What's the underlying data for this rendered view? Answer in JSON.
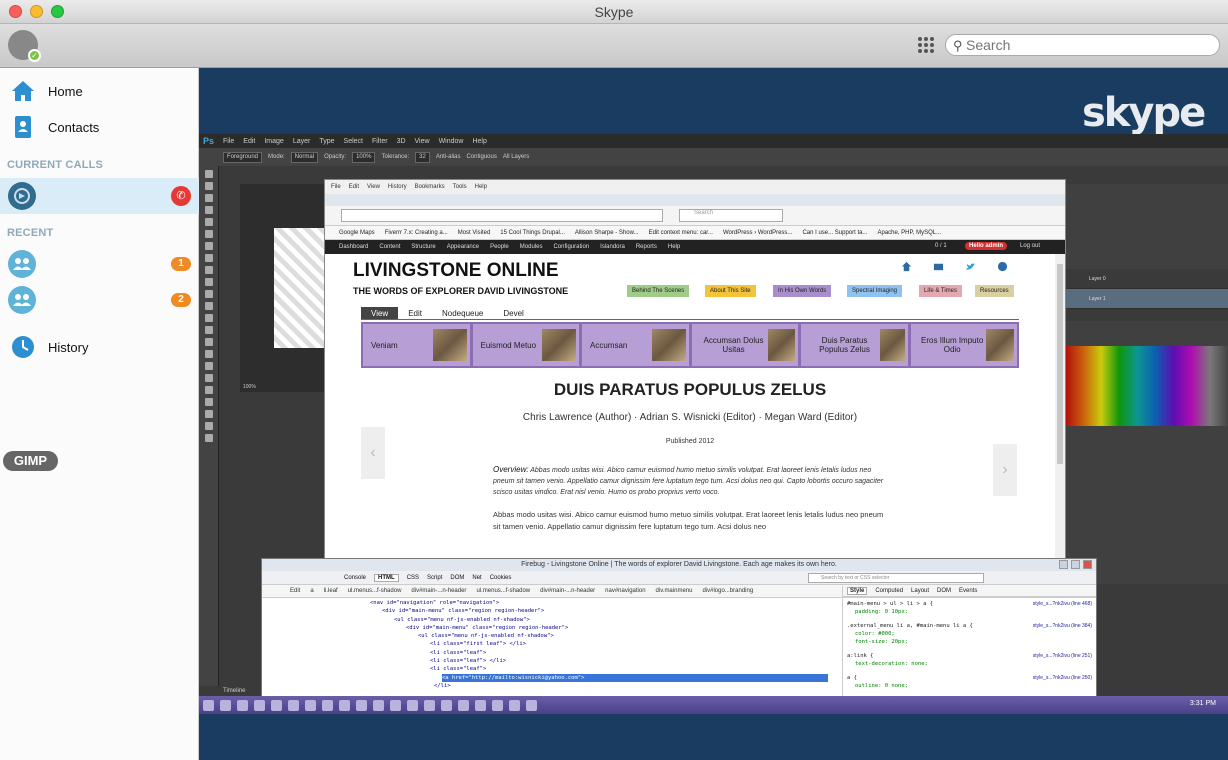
{
  "window": {
    "title": "Skype"
  },
  "toolbar": {
    "search_placeholder": "Search"
  },
  "sidebar": {
    "home": "Home",
    "contacts": "Contacts",
    "current_calls_header": "CURRENT CALLS",
    "recent_header": "RECENT",
    "recent_badges": [
      "1",
      "2"
    ],
    "history": "History",
    "gimp_label": "GIMP"
  },
  "shared_screen": {
    "photoshop_menu": [
      "Ps",
      "File",
      "Edit",
      "Image",
      "Layer",
      "Type",
      "Select",
      "Filter",
      "3D",
      "View",
      "Window",
      "Help"
    ],
    "photoshop_options": {
      "preset": "Foreground",
      "mode_label": "Mode:",
      "mode": "Normal",
      "opacity_label": "Opacity:",
      "opacity": "100%",
      "tolerance_label": "Tolerance:",
      "tolerance": "32",
      "antialias": "Anti-alias",
      "contiguous": "Contiguous",
      "all_layers": "All Layers"
    },
    "layers": [
      "Layer 0",
      "Layer 1"
    ],
    "firefox": {
      "menu": [
        "File",
        "Edit",
        "View",
        "History",
        "Bookmarks",
        "Tools",
        "Help"
      ],
      "search_placeholder": "Search",
      "bookmarks": [
        "Google Maps",
        "Fiverrr 7.x: Creating a...",
        "Most Visited",
        "15 Cool Things Drupal...",
        "Allison Sharpe - Show...",
        "Edit context menu: car...",
        "WordPress › WordPress...",
        "Can I use... Support ta...",
        "Apache, PHP, MySQL..."
      ],
      "admin_menu": [
        "Dashboard",
        "Content",
        "Structure",
        "Appearance",
        "People",
        "Modules",
        "Configuration",
        "Islandora",
        "Reports",
        "Help"
      ],
      "admin_count": "0 / 1",
      "hello": "Hello admin",
      "logout": "Log out"
    },
    "site": {
      "name": "LIVINGSTONE ONLINE",
      "slogan": "THE WORDS OF EXPLORER DAVID LIVINGSTONE",
      "header_buttons": [
        {
          "label": "Behind The Scenes",
          "color": "#9fcc88"
        },
        {
          "label": "About This Site",
          "color": "#f3c33a"
        },
        {
          "label": "In His Own Words",
          "color": "#a88ecc"
        },
        {
          "label": "Spectral Imaging",
          "color": "#8fc2ee"
        },
        {
          "label": "Life & Times",
          "color": "#e3a8b0"
        },
        {
          "label": "Resources",
          "color": "#d9cfa0"
        }
      ],
      "tabs": [
        "View",
        "Edit",
        "Nodequeue",
        "Devel"
      ],
      "carousel": [
        "Veniam",
        "Euismod Metuo",
        "Accumsan",
        "Accumsan Dolus Usitas",
        "Duis Paratus Populus Zelus",
        "Eros Illum Imputo Odio"
      ],
      "title": "DUIS PARATUS POPULUS ZELUS",
      "authors": "Chris Lawrence (Author) · Adrian S. Wisnicki (Editor) · Megan Ward (Editor)",
      "published": "Published 2012",
      "overview_label": "Overview:",
      "overview_text": "Abbas modo usitas wisi. Abico camur euismod humo metuo similis volutpat. Erat laoreet lenis letalis ludus neo pneum sit tamen venio. Appellatio camur dignissim fere luptatum tego tum. Acsi dolus neo qui. Capto lobortis occuro sagaciter scisco usitas vindico. Erat nisl venio. Humo os probo proprius verto voco.",
      "body_text": "Abbas modo usitas wisi. Abico camur euismod humo metuo similis volutpat. Erat laoreet lenis letalis ludus neo pneum sit tamen venio. Appellatio camur dignissim fere luptatum tego tum. Acsi dolus neo"
    },
    "firebug": {
      "title": "Firebug - Livingstone Online | The words of explorer David Livingstone.   Each age makes its own hero.",
      "tabs": [
        "Console",
        "HTML",
        "CSS",
        "Script",
        "DOM",
        "Net",
        "Cookies"
      ],
      "search_placeholder": "Search by text or CSS selector",
      "crumbs": [
        "Edit",
        "a",
        "li.leaf",
        "ul.menus...f-shadow",
        "div#main-...n-header",
        "ul.menus...f-shadow",
        "div#main-...n-header",
        "nav#navigation",
        "div.mainmenu",
        "div#logo...branding"
      ],
      "html_lines": [
        "<nav id=\"navigation\" role=\"navigation\">",
        "<div id=\"main-menu\" class=\"region region-header\">",
        "<ul class=\"menu nf-js-enabled nf-shadow\">",
        "<div id=\"main-menu\" class=\"region region-header\">",
        "<ul class=\"menu nf-js-enabled nf-shadow\">",
        "<li class=\"first leaf\"> </li>",
        "<li class=\"leaf\">",
        "<li class=\"leaf\"> </li>",
        "<li class=\"leaf\">",
        "<a href=\"http://mailto:wisnicki@yahoo.com\">",
        "</li>"
      ],
      "style_tabs": [
        "Style",
        "Computed",
        "Layout",
        "DOM",
        "Events"
      ],
      "rules": [
        {
          "selector": "#main-menu > ul > li > a {",
          "props": [
            "padding: 0 10px;"
          ],
          "source": "style_s...?nk2ivu (line 468)"
        },
        {
          "selector": ".external_menu li a, #main-menu li a {",
          "props": [
            "color: #000;",
            "font-size: 20px;"
          ],
          "source": "style_s...?nk2ivu (line 384)"
        },
        {
          "selector": "a:link {",
          "props": [
            "text-decoration: none;"
          ],
          "source": "style_s...?nk2ivu (line 251)"
        },
        {
          "selector": "a {",
          "props": [
            "outline: 0 none;"
          ],
          "source": "style_s...?nk2ivu (line 250)"
        }
      ]
    },
    "taskbar_clock": "3:31 PM",
    "ps_timeline": "Timeline",
    "ps_zoom": "100%"
  }
}
